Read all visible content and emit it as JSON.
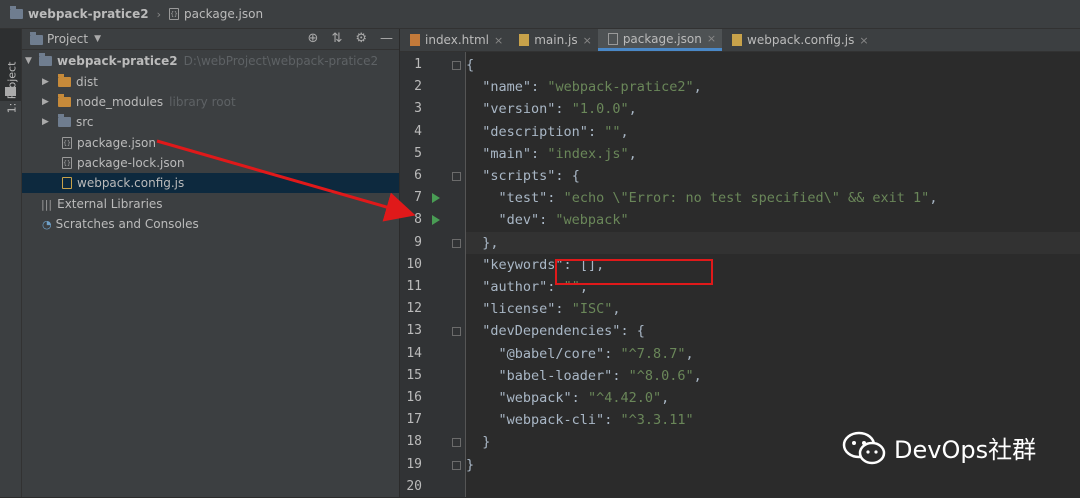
{
  "breadcrumb": {
    "project": "webpack-pratice2",
    "file": "package.json"
  },
  "side_stripe": {
    "label": "1: Project"
  },
  "project_panel": {
    "title": "Project",
    "tree": [
      {
        "label": "webpack-pratice2",
        "hint": "D:\\webProject\\webpack-pratice2",
        "icon": "folder-icon",
        "expanded": true
      },
      {
        "label": "dist",
        "icon": "folder-icon"
      },
      {
        "label": "node_modules",
        "hint": "library root",
        "icon": "folder-icon"
      },
      {
        "label": "src",
        "icon": "folder-icon"
      },
      {
        "label": "package.json",
        "icon": "json-file-icon"
      },
      {
        "label": "package-lock.json",
        "icon": "json-file-icon"
      },
      {
        "label": "webpack.config.js",
        "icon": "js-file-icon",
        "selected": true
      },
      {
        "label": "External Libraries",
        "icon": "library-icon"
      },
      {
        "label": "Scratches and Consoles",
        "icon": "scratches-icon"
      }
    ]
  },
  "tabs": [
    {
      "label": "index.html",
      "icon": "html-file-icon"
    },
    {
      "label": "main.js",
      "icon": "js-file-icon"
    },
    {
      "label": "package.json",
      "icon": "json-file-icon",
      "active": true
    },
    {
      "label": "webpack.config.js",
      "icon": "js-file-icon"
    }
  ],
  "code_lines": [
    "{",
    "  \"name\": \"webpack-pratice2\",",
    "  \"version\": \"1.0.0\",",
    "  \"description\": \"\",",
    "  \"main\": \"index.js\",",
    "  \"scripts\": {",
    "    \"test\": \"echo \\\"Error: no test specified\\\" && exit 1\",",
    "    \"dev\": \"webpack\"",
    "  },",
    "  \"keywords\": [],",
    "  \"author\": \"\",",
    "  \"license\": \"ISC\",",
    "  \"devDependencies\": {",
    "    \"@babel/core\": \"^7.8.7\",",
    "    \"babel-loader\": \"^8.0.6\",",
    "    \"webpack\": \"^4.42.0\",",
    "    \"webpack-cli\": \"^3.3.11\"",
    "  }",
    "}",
    ""
  ],
  "current_line": 9,
  "run_gutter_lines": [
    7,
    8
  ],
  "annotation": {
    "highlighted_line": 8,
    "color": "#e0191a"
  },
  "watermark": "DevOps社群",
  "colors": {
    "string": "#6a8759",
    "key": "#a9b7c6",
    "accent": "#4a88c7"
  }
}
